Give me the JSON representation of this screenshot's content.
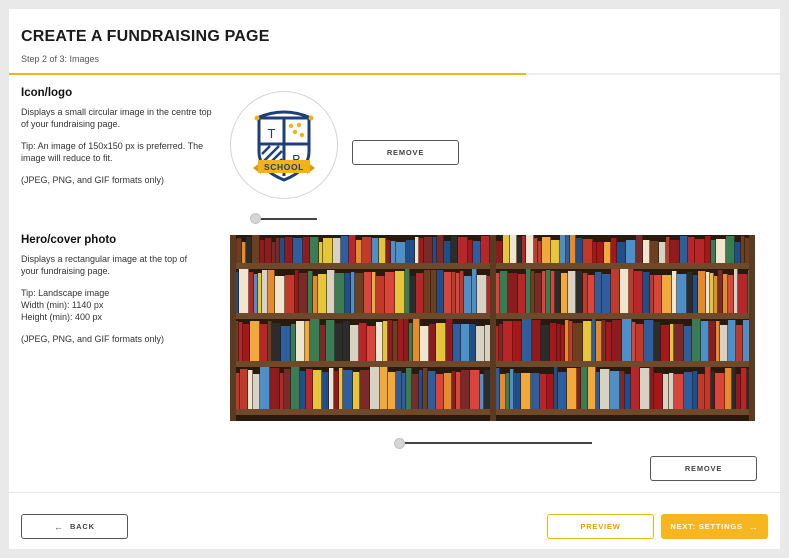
{
  "header": {
    "title": "CREATE A FUNDRAISING PAGE",
    "step": "Step 2 of 3: Images",
    "progress": 0.67,
    "accent_color": "#f2b318"
  },
  "icon_section": {
    "heading": "Icon/logo",
    "description": "Displays a small circular image in the centre top of your fundraising page.",
    "tip": "Tip: An image of 150x150 px is preferred. The image will reduce to fit.",
    "formats": "(JPEG, PNG, and GIF formats only)",
    "logo": {
      "letter_1": "T",
      "letter_2": "B",
      "banner_text": "SCHOOL",
      "navy": "#1e3f7a",
      "gold": "#f2b318"
    },
    "remove_label": "REMOVE",
    "zoom_slider": 0
  },
  "hero_section": {
    "heading": "Hero/cover photo",
    "description": "Displays a rectangular image at the top of your fundraising page.",
    "tip_1": "Tip: Landscape image",
    "tip_2": "Width (min): 1140 px",
    "tip_3": "Height (min): 400 px",
    "formats": "(JPEG, PNG, and GIF formats only)",
    "remove_label": "REMOVE",
    "zoom_slider": 0
  },
  "footer": {
    "back_label": "BACK",
    "back_icon": "arrow-left-icon",
    "preview_label": "PREVIEW",
    "next_label": "NEXT: SETTINGS",
    "next_icon": "arrow-right-icon"
  }
}
